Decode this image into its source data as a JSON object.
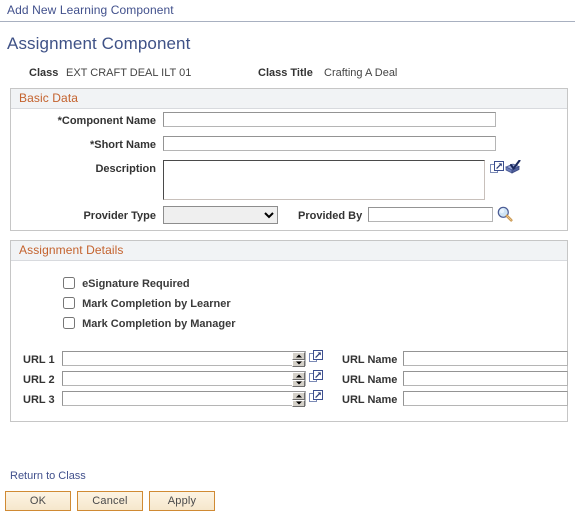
{
  "breadcrumb": {
    "link_label": "Add New Learning Component"
  },
  "page": {
    "title": "Assignment Component"
  },
  "class_header": {
    "class_label": "Class",
    "class_value": "EXT CRAFT DEAL ILT 01",
    "class_title_label": "Class Title",
    "class_title_value": "Crafting A Deal"
  },
  "basic_data": {
    "section_title": "Basic Data",
    "component_name": {
      "label": "*Component Name",
      "value": "",
      "placeholder": ""
    },
    "short_name": {
      "label": "*Short Name",
      "value": "",
      "placeholder": ""
    },
    "description": {
      "label": "Description",
      "value": "",
      "placeholder": "",
      "expand_icon": "expand-popup-icon",
      "spellcheck_icon": "spell-check-icon"
    },
    "provider_type": {
      "label": "Provider Type",
      "selected": "",
      "options": [
        ""
      ]
    },
    "provided_by": {
      "label": "Provided By",
      "value": "",
      "placeholder": "",
      "lookup_icon": "magnifier-lookup-icon"
    }
  },
  "assignment_details": {
    "section_title": "Assignment Details",
    "checkboxes": [
      {
        "label": "eSignature Required",
        "checked": false
      },
      {
        "label": "Mark Completion by Learner",
        "checked": false
      },
      {
        "label": "Mark Completion by Manager",
        "checked": false
      }
    ],
    "urls": [
      {
        "label": "URL 1",
        "value": "",
        "name_label": "URL Name",
        "name_value": ""
      },
      {
        "label": "URL 2",
        "value": "",
        "name_label": "URL Name",
        "name_value": ""
      },
      {
        "label": "URL 3",
        "value": "",
        "name_label": "URL Name",
        "name_value": ""
      }
    ]
  },
  "footer": {
    "return_link": "Return to Class",
    "buttons": [
      {
        "label": "OK"
      },
      {
        "label": "Cancel"
      },
      {
        "label": "Apply"
      }
    ]
  },
  "colors": {
    "link": "#41508c",
    "title": "#3f5287",
    "section_header_text": "#c4622d",
    "section_header_bg": "#f1f3f5",
    "button_border": "#d08a33",
    "button_bg": "#fdf4e4"
  }
}
